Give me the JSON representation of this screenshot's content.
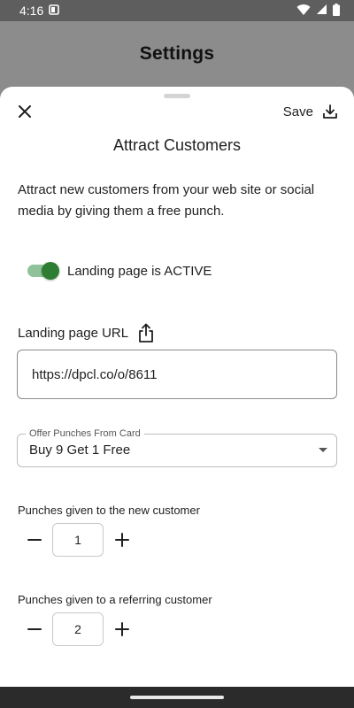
{
  "status_bar": {
    "time": "4:16",
    "icons": [
      "notification-square-icon",
      "wifi-icon",
      "signal-icon",
      "battery-icon"
    ]
  },
  "header": {
    "title": "Settings"
  },
  "sheet": {
    "save_label": "Save",
    "title": "Attract Customers",
    "description": "Attract new customers from your web site or social media by giving them a free punch.",
    "toggle": {
      "label": "Landing page is ACTIVE",
      "on": true
    },
    "url": {
      "label": "Landing page URL",
      "value": "https://dpcl.co/o/8611"
    },
    "offer_select": {
      "legend": "Offer Punches From Card",
      "value": "Buy 9 Get 1 Free"
    },
    "new_customer": {
      "label": "Punches given to the new customer",
      "value": "1"
    },
    "referring_customer": {
      "label": "Punches given to a referring customer",
      "value": "2"
    }
  },
  "colors": {
    "toggle_thumb": "#2e7d32",
    "toggle_track": "#8fc19a",
    "overlay": "#8c8c8c"
  }
}
